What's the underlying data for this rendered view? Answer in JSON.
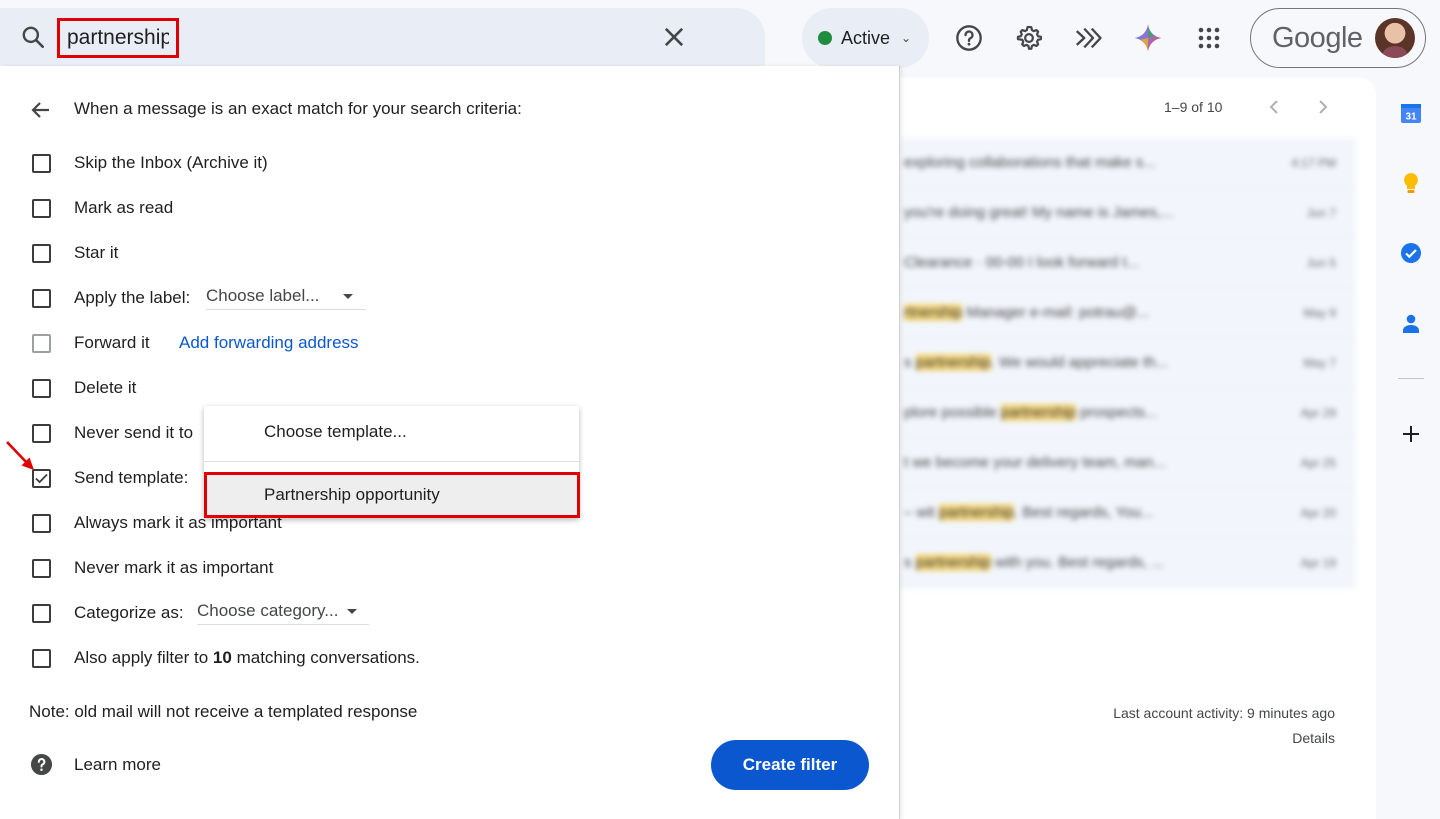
{
  "search": {
    "query": "partnership"
  },
  "status": {
    "label": "Active"
  },
  "brand": {
    "logo_text": "Google"
  },
  "filter": {
    "heading": "When a message is an exact match for your search criteria:",
    "options": [
      {
        "label": "Skip the Inbox (Archive it)",
        "checked": false
      },
      {
        "label": "Mark as read",
        "checked": false
      },
      {
        "label": "Star it",
        "checked": false
      },
      {
        "label": "Apply the label:",
        "select": "Choose label...",
        "checked": false
      },
      {
        "label": "Forward it",
        "link": "Add forwarding address",
        "checked": false,
        "disabled": true
      },
      {
        "label": "Delete it",
        "checked": false
      },
      {
        "label": "Never send it to",
        "checked": false
      },
      {
        "label": "Send template:",
        "checked": true
      },
      {
        "label": "Always mark it as important",
        "checked": false
      },
      {
        "label": "Never mark it as important",
        "checked": false
      },
      {
        "label": "Categorize as:",
        "select": "Choose category...",
        "checked": false
      },
      {
        "label_prefix": "Also apply filter to",
        "count": "10",
        "label_suffix": "matching conversations.",
        "checked": false
      }
    ],
    "note": "Note: old mail will not receive a templated response",
    "learn_more": "Learn more",
    "create_button": "Create filter"
  },
  "template_menu": {
    "items": [
      "Choose template...",
      "Partnership opportunity"
    ],
    "selected_index": 1
  },
  "mail_list": {
    "pager": "1–9 of 10",
    "last_activity": "Last account activity: 9 minutes ago",
    "details": "Details",
    "rows": [
      {
        "pre": "exploring collaborations that make s...",
        "hl": "",
        "post": "",
        "date": "4:17 PM"
      },
      {
        "pre": "you're doing great! My name is James,...",
        "hl": "",
        "post": "",
        "date": "Jun 7"
      },
      {
        "pre": "Clearance · 00-00 I look forward t...",
        "hl": "",
        "post": "",
        "date": "Jun 5"
      },
      {
        "pre": "",
        "hl": "rtnership",
        "post": " Manager e-mail: potrau@...",
        "date": "May 9"
      },
      {
        "pre": "s ",
        "hl": "partnership",
        "post": ". We would appreciate th...",
        "date": "May 7"
      },
      {
        "pre": "plore possible ",
        "hl": "partnership",
        "post": " prospects...",
        "date": "Apr 29"
      },
      {
        "pre": "t we become your delivery team, man...",
        "hl": "",
        "post": "",
        "date": "Apr 25"
      },
      {
        "pre": "  – wit ",
        "hl": "partnership",
        "post": ". Best regards, You...",
        "date": "Apr 20"
      },
      {
        "pre": "s ",
        "hl": "partnership",
        "post": " with you. Best regards, ...",
        "date": "Apr 19"
      }
    ]
  },
  "colors": {
    "primary_button": "#0b57d0",
    "annotation_red": "#e00000",
    "status_green": "#1e8e3e"
  },
  "icons": {
    "top": [
      "search-icon",
      "close-icon",
      "help-icon",
      "settings-icon",
      "gemini-chevron-icon",
      "gemini-sparkle-icon",
      "apps-grid-icon"
    ],
    "side": [
      "calendar-icon",
      "keep-icon",
      "tasks-icon",
      "contacts-icon",
      "add-icon"
    ],
    "side_calendar_text": "31"
  }
}
